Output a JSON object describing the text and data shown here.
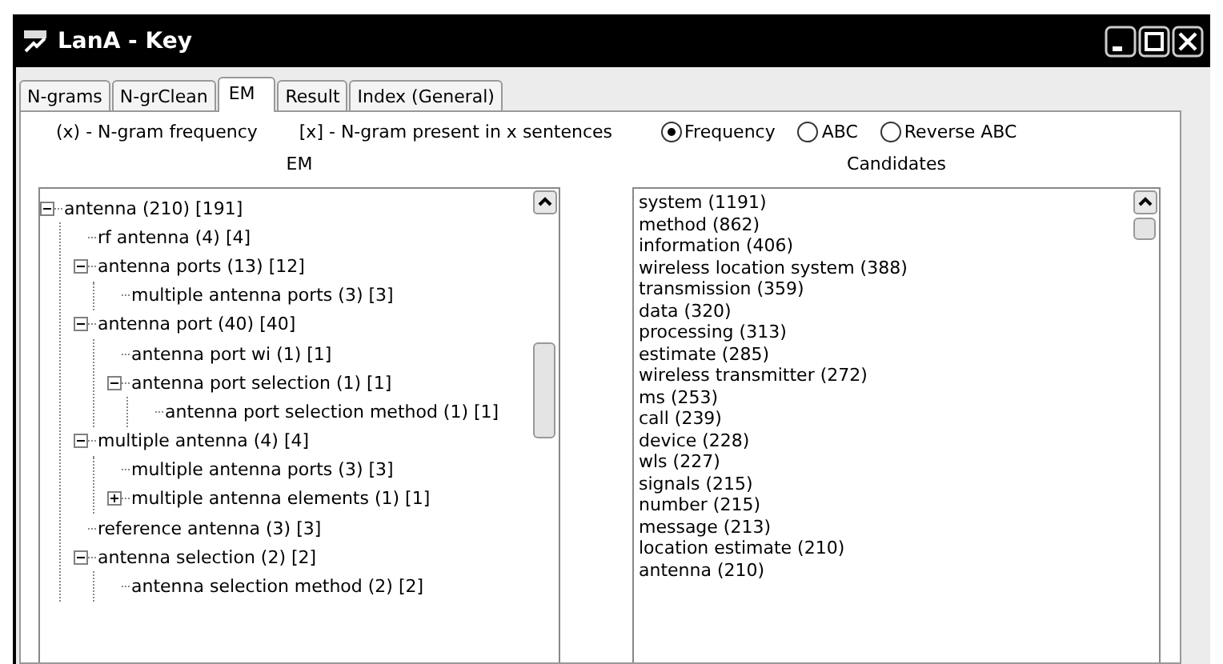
{
  "window": {
    "title": "LanA - Key"
  },
  "tabs": [
    {
      "label": "N-grams",
      "selected": false
    },
    {
      "label": "N-grClean",
      "selected": false
    },
    {
      "label": "EM",
      "selected": true
    },
    {
      "label": "Result",
      "selected": false
    },
    {
      "label": "Index (General)",
      "selected": false
    }
  ],
  "legend": [
    "(x) - N-gram frequency",
    "[x] - N-gram present in x sentences"
  ],
  "sort_options": [
    {
      "label": "Frequency",
      "selected": true
    },
    {
      "label": "ABC",
      "selected": false
    },
    {
      "label": "Reverse ABC",
      "selected": false
    }
  ],
  "em_panel": {
    "heading": "EM",
    "tree": [
      {
        "label": "antenna (210) [191]",
        "expanded": true,
        "children": [
          {
            "label": "rf antenna (4) [4]"
          },
          {
            "label": "antenna ports (13) [12]",
            "expanded": true,
            "children": [
              {
                "label": "multiple antenna ports (3) [3]"
              }
            ]
          },
          {
            "label": "antenna port (40) [40]",
            "expanded": true,
            "children": [
              {
                "label": "antenna port wi (1) [1]"
              },
              {
                "label": "antenna port selection (1) [1]",
                "expanded": true,
                "children": [
                  {
                    "label": "antenna port selection method (1) [1]"
                  }
                ]
              }
            ]
          },
          {
            "label": "multiple antenna (4) [4]",
            "expanded": true,
            "children": [
              {
                "label": "multiple antenna ports (3) [3]"
              },
              {
                "label": "multiple antenna elements (1) [1]",
                "expanded": false
              }
            ]
          },
          {
            "label": "reference antenna (3) [3]"
          },
          {
            "label": "antenna selection (2) [2]",
            "expanded": true,
            "children": [
              {
                "label": "antenna selection method (2) [2]"
              }
            ]
          }
        ]
      }
    ]
  },
  "candidates_panel": {
    "heading": "Candidates",
    "items": [
      "system (1191)",
      "method (862)",
      "information (406)",
      "wireless location system (388)",
      "transmission (359)",
      "data (320)",
      "processing (313)",
      "estimate (285)",
      "wireless transmitter (272)",
      "ms (253)",
      "call (239)",
      "device (228)",
      "wls (227)",
      "signals (215)",
      "number (215)",
      "message (213)",
      "location estimate (210)",
      "antenna (210)"
    ]
  }
}
